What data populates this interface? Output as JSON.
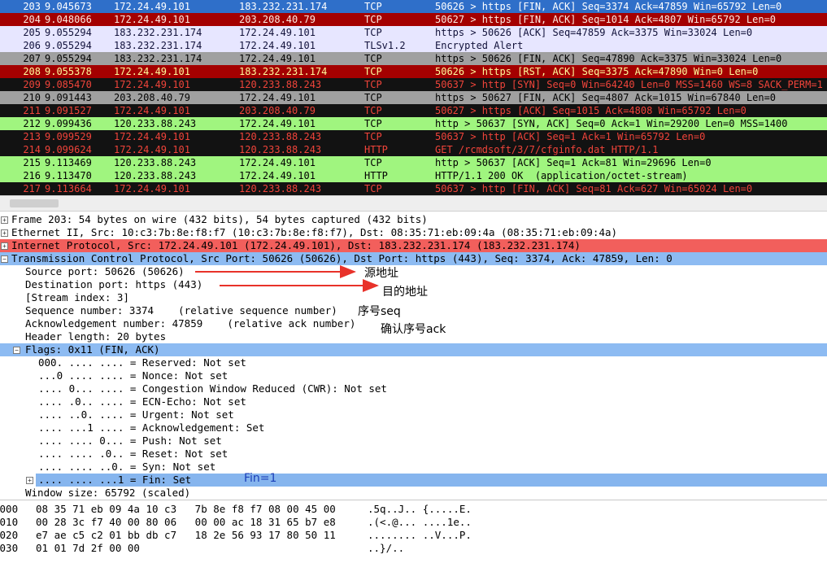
{
  "packets": [
    {
      "no": "203",
      "time": "9.045673",
      "src": "172.24.49.101",
      "dst": "183.232.231.174",
      "proto": "TCP",
      "info": "50626 > https [FIN, ACK] Seq=3374 Ack=47859 Win=65792 Len=0",
      "bg": "#2f6fc9",
      "fg": "#ffffff"
    },
    {
      "no": "204",
      "time": "9.048066",
      "src": "172.24.49.101",
      "dst": "203.208.40.79",
      "proto": "TCP",
      "info": "50627 > https [FIN, ACK] Seq=1014 Ack=4807 Win=65792 Len=0",
      "bg": "#a40000",
      "fg": "#ffe9e0"
    },
    {
      "no": "205",
      "time": "9.055294",
      "src": "183.232.231.174",
      "dst": "172.24.49.101",
      "proto": "TCP",
      "info": "https > 50626 [ACK] Seq=47859 Ack=3375 Win=33024 Len=0",
      "bg": "#e7e6ff",
      "fg": "#12123a"
    },
    {
      "no": "206",
      "time": "9.055294",
      "src": "183.232.231.174",
      "dst": "172.24.49.101",
      "proto": "TLSv1.2",
      "info": "Encrypted Alert",
      "bg": "#e7e6ff",
      "fg": "#12123a"
    },
    {
      "no": "207",
      "time": "9.055294",
      "src": "183.232.231.174",
      "dst": "172.24.49.101",
      "proto": "TCP",
      "info": "https > 50626 [FIN, ACK] Seq=47890 Ack=3375 Win=33024 Len=0",
      "bg": "#a0a0a0",
      "fg": "#000000"
    },
    {
      "no": "208",
      "time": "9.055378",
      "src": "172.24.49.101",
      "dst": "183.232.231.174",
      "proto": "TCP",
      "info": "50626 > https [RST, ACK] Seq=3375 Ack=47890 Win=0 Len=0",
      "bg": "#a40000",
      "fg": "#fffc9c"
    },
    {
      "no": "209",
      "time": "9.085470",
      "src": "172.24.49.101",
      "dst": "120.233.88.243",
      "proto": "TCP",
      "info": "50637 > http [SYN] Seq=0 Win=64240 Len=0 MSS=1460 WS=8 SACK_PERM=1",
      "bg": "#121212",
      "fg": "#f0443a"
    },
    {
      "no": "210",
      "time": "9.091443",
      "src": "203.208.40.79",
      "dst": "172.24.49.101",
      "proto": "TCP",
      "info": "https > 50627 [FIN, ACK] Seq=4807 Ack=1015 Win=67840 Len=0",
      "bg": "#a0a0a0",
      "fg": "#000000"
    },
    {
      "no": "211",
      "time": "9.091527",
      "src": "172.24.49.101",
      "dst": "203.208.40.79",
      "proto": "TCP",
      "info": "50627 > https [ACK] Seq=1015 Ack=4808 Win=65792 Len=0",
      "bg": "#121212",
      "fg": "#f0443a"
    },
    {
      "no": "212",
      "time": "9.099436",
      "src": "120.233.88.243",
      "dst": "172.24.49.101",
      "proto": "TCP",
      "info": "http > 50637 [SYN, ACK] Seq=0 Ack=1 Win=29200 Len=0 MSS=1400",
      "bg": "#a0f57f",
      "fg": "#000000"
    },
    {
      "no": "213",
      "time": "9.099529",
      "src": "172.24.49.101",
      "dst": "120.233.88.243",
      "proto": "TCP",
      "info": "50637 > http [ACK] Seq=1 Ack=1 Win=65792 Len=0",
      "bg": "#121212",
      "fg": "#f0443a"
    },
    {
      "no": "214",
      "time": "9.099624",
      "src": "172.24.49.101",
      "dst": "120.233.88.243",
      "proto": "HTTP",
      "info": "GET /rcmdsoft/3/7/cfginfo.dat HTTP/1.1",
      "bg": "#121212",
      "fg": "#f0443a"
    },
    {
      "no": "215",
      "time": "9.113469",
      "src": "120.233.88.243",
      "dst": "172.24.49.101",
      "proto": "TCP",
      "info": "http > 50637 [ACK] Seq=1 Ack=81 Win=29696 Len=0",
      "bg": "#a0f57f",
      "fg": "#000000"
    },
    {
      "no": "216",
      "time": "9.113470",
      "src": "120.233.88.243",
      "dst": "172.24.49.101",
      "proto": "HTTP",
      "info": "HTTP/1.1 200 OK  (application/octet-stream)",
      "bg": "#a0f57f",
      "fg": "#000000"
    },
    {
      "no": "217",
      "time": "9.113664",
      "src": "172.24.49.101",
      "dst": "120.233.88.243",
      "proto": "TCP",
      "info": "50637 > http [FIN, ACK] Seq=81 Ack=627 Win=65024 Len=0",
      "bg": "#121212",
      "fg": "#f0443a"
    }
  ],
  "details": [
    {
      "text": "Frame 203: 54 bytes on wire (432 bits), 54 bytes captured (432 bits)",
      "indent": 0,
      "expander": "+",
      "hl": ""
    },
    {
      "text": "Ethernet II, Src: 10:c3:7b:8e:f8:f7 (10:c3:7b:8e:f8:f7), Dst: 08:35:71:eb:09:4a (08:35:71:eb:09:4a)",
      "indent": 0,
      "expander": "+",
      "hl": ""
    },
    {
      "text": "Internet Protocol, Src: 172.24.49.101 (172.24.49.101), Dst: 183.232.231.174 (183.232.231.174)",
      "indent": 0,
      "expander": "+",
      "hl": "red"
    },
    {
      "text": "Transmission Control Protocol, Src Port: 50626 (50626), Dst Port: https (443), Seq: 3374, Ack: 47859, Len: 0",
      "indent": 0,
      "expander": "-",
      "hl": "blue"
    },
    {
      "text": "Source port: 50626 (50626)",
      "indent": 1,
      "expander": "",
      "hl": ""
    },
    {
      "text": "Destination port: https (443)",
      "indent": 1,
      "expander": "",
      "hl": ""
    },
    {
      "text": "[Stream index: 3]",
      "indent": 1,
      "expander": "",
      "hl": ""
    },
    {
      "text": "Sequence number: 3374    (relative sequence number)",
      "indent": 1,
      "expander": "",
      "hl": ""
    },
    {
      "text": "Acknowledgement number: 47859    (relative ack number)",
      "indent": 1,
      "expander": "",
      "hl": ""
    },
    {
      "text": "Header length: 20 bytes",
      "indent": 1,
      "expander": "",
      "hl": ""
    },
    {
      "text": "Flags: 0x11 (FIN, ACK)",
      "indent": 1,
      "expander": "-",
      "hl": "blue"
    },
    {
      "text": "000. .... .... = Reserved: Not set",
      "indent": 2,
      "expander": "",
      "hl": ""
    },
    {
      "text": "...0 .... .... = Nonce: Not set",
      "indent": 2,
      "expander": "",
      "hl": ""
    },
    {
      "text": ".... 0... .... = Congestion Window Reduced (CWR): Not set",
      "indent": 2,
      "expander": "",
      "hl": ""
    },
    {
      "text": ".... .0.. .... = ECN-Echo: Not set",
      "indent": 2,
      "expander": "",
      "hl": ""
    },
    {
      "text": ".... ..0. .... = Urgent: Not set",
      "indent": 2,
      "expander": "",
      "hl": ""
    },
    {
      "text": ".... ...1 .... = Acknowledgement: Set",
      "indent": 2,
      "expander": "",
      "hl": ""
    },
    {
      "text": ".... .... 0... = Push: Not set",
      "indent": 2,
      "expander": "",
      "hl": ""
    },
    {
      "text": ".... .... .0.. = Reset: Not set",
      "indent": 2,
      "expander": "",
      "hl": ""
    },
    {
      "text": ".... .... ..0. = Syn: Not set",
      "indent": 2,
      "expander": "",
      "hl": ""
    },
    {
      "text": ".... .... ...1 = Fin: Set",
      "indent": 2,
      "expander": "+",
      "hl": "blue2"
    },
    {
      "text": "Window size: 65792 (scaled)",
      "indent": 1,
      "expander": "",
      "hl": ""
    }
  ],
  "hex": [
    {
      "offset": "0000",
      "bytes": "08 35 71 eb 09 4a 10 c3   7b 8e f8 f7 08 00 45 00",
      "ascii": ".5q..J.. {.....E."
    },
    {
      "offset": "0010",
      "bytes": "00 28 3c f7 40 00 80 06   00 00 ac 18 31 65 b7 e8",
      "ascii": ".(<.@... ....1e.."
    },
    {
      "offset": "0020",
      "bytes": "e7 ae c5 c2 01 bb db c7   18 2e 56 93 17 80 50 11",
      "ascii": "........ ..V...P."
    },
    {
      "offset": "0030",
      "bytes": "01 01 7d 2f 00 00",
      "ascii": "..}/.."
    }
  ],
  "annotations": {
    "src_addr": "源地址",
    "dst_addr": "目的地址",
    "seq": "序号seq",
    "ack": "确认序号ack",
    "fin": "Fin=1"
  },
  "colors": {
    "arrow": "#e8322a",
    "annotation_fin": "#1b3fb8"
  }
}
